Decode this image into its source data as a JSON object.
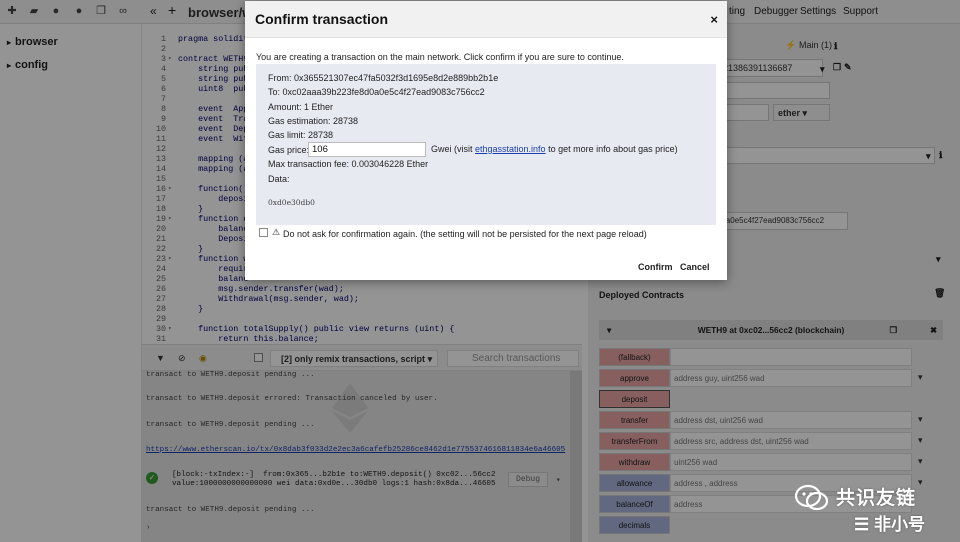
{
  "topbar": {
    "tab_name": "browser/we",
    "collapse_label": "«",
    "add_label": "+",
    "right_tabs": [
      "ting",
      "Debugger",
      "Settings",
      "Support"
    ]
  },
  "explorer": {
    "folders": [
      "browser",
      "config"
    ]
  },
  "editor": {
    "lines": [
      {
        "n": "1",
        "fold": "",
        "text": "pragma solidit"
      },
      {
        "n": "2",
        "fold": "",
        "text": ""
      },
      {
        "n": "3",
        "fold": "▾",
        "text": "contract WETH9"
      },
      {
        "n": "4",
        "fold": "",
        "text": "    string pub"
      },
      {
        "n": "5",
        "fold": "",
        "text": "    string pub"
      },
      {
        "n": "6",
        "fold": "",
        "text": "    uint8  pub"
      },
      {
        "n": "7",
        "fold": "",
        "text": ""
      },
      {
        "n": "8",
        "fold": "",
        "text": "    event  App"
      },
      {
        "n": "9",
        "fold": "",
        "text": "    event  Tra"
      },
      {
        "n": "10",
        "fold": "",
        "text": "    event  Dep"
      },
      {
        "n": "11",
        "fold": "",
        "text": "    event  Wit"
      },
      {
        "n": "12",
        "fold": "",
        "text": ""
      },
      {
        "n": "13",
        "fold": "",
        "text": "    mapping (a"
      },
      {
        "n": "14",
        "fold": "",
        "text": "    mapping (a"
      },
      {
        "n": "15",
        "fold": "",
        "text": ""
      },
      {
        "n": "16",
        "fold": "▾",
        "text": "    function()"
      },
      {
        "n": "17",
        "fold": "",
        "text": "        deposi"
      },
      {
        "n": "18",
        "fold": "",
        "text": "    }"
      },
      {
        "n": "19",
        "fold": "▾",
        "text": "    function d"
      },
      {
        "n": "20",
        "fold": "",
        "text": "        balanc"
      },
      {
        "n": "21",
        "fold": "",
        "text": "        Deposi"
      },
      {
        "n": "22",
        "fold": "",
        "text": "    }"
      },
      {
        "n": "23",
        "fold": "▾",
        "text": "    function w"
      },
      {
        "n": "24",
        "fold": "",
        "text": "        requir"
      },
      {
        "n": "25",
        "fold": "",
        "text": "        balanc"
      },
      {
        "n": "26",
        "fold": "",
        "text": "        msg.sender.transfer(wad);"
      },
      {
        "n": "27",
        "fold": "",
        "text": "        Withdrawal(msg.sender, wad);"
      },
      {
        "n": "28",
        "fold": "",
        "text": "    }"
      },
      {
        "n": "29",
        "fold": "",
        "text": ""
      },
      {
        "n": "30",
        "fold": "▾",
        "text": "    function totalSupply() public view returns (uint) {"
      },
      {
        "n": "31",
        "fold": "",
        "text": "        return this.balance;"
      },
      {
        "n": "32",
        "fold": "",
        "text": "    }"
      }
    ]
  },
  "terminal_toolbar": {
    "filter_label": "[2] only remix transactions, script",
    "search_placeholder": "Search transactions"
  },
  "terminal": {
    "line1": "transact to WETH9.deposit pending ...",
    "line2": "transact to WETH9.deposit errored: Transaction canceled by user.",
    "line3": "transact to WETH9.deposit pending ...",
    "line4": "https://www.etherscan.io/tx/0x8dab3f033d2e2ec3a6cafefb25286ce8462d1e7755374616811834e6a46605",
    "line5a": "[block:-txIndex:-]  from:0x365...b2b1e to:WETH9.deposit() 0xc02...56cc2",
    "line5b": "value:1000000000000000 wei data:0xd0e...30db0 logs:1 hash:0x8da...46605",
    "debug_label": "Debug",
    "line6": "transact to WETH9.deposit pending ..."
  },
  "runpanel": {
    "network": "Main (1)",
    "account": "51421386391136687",
    "value_unit": "ether",
    "address_display": "e8d0a0e5c4f27ead9083c756cc2",
    "deployed_title": "Deployed Contracts",
    "instance_title": "WETH9 at 0xc02...56cc2 (blockchain)",
    "functions": [
      {
        "label": "(fallback)",
        "kind": "tx",
        "input": "",
        "chev": false
      },
      {
        "label": "approve",
        "kind": "tx",
        "input": "address guy, uint256 wad",
        "chev": true
      },
      {
        "label": "deposit",
        "kind": "pay",
        "input": "",
        "chev": false
      },
      {
        "label": "transfer",
        "kind": "tx",
        "input": "address dst, uint256 wad",
        "chev": true
      },
      {
        "label": "transferFrom",
        "kind": "tx",
        "input": "address src, address dst, uint256 wad",
        "chev": true
      },
      {
        "label": "withdraw",
        "kind": "tx",
        "input": "uint256 wad",
        "chev": true
      },
      {
        "label": "allowance",
        "kind": "view",
        "input": "address , address",
        "chev": true
      },
      {
        "label": "balanceOf",
        "kind": "view",
        "input": "address",
        "chev": false
      },
      {
        "label": "decimals",
        "kind": "view",
        "input": "",
        "chev": false
      }
    ]
  },
  "modal": {
    "title": "Confirm transaction",
    "close": "×",
    "intro": "You are creating a transaction on the main network. Click confirm if you are sure to continue.",
    "from": "From: 0x365521307ec47fa5032f3d1695e8d2e889bb2b1e",
    "to": "To: 0xc02aaa39b223fe8d0a0e5c4f27ead9083c756cc2",
    "amount": "Amount: 1 Ether",
    "gas_estimation": "Gas estimation: 28738",
    "gas_limit": "Gas limit: 28738",
    "gas_price_label": "Gas price:",
    "gas_price_value": "106",
    "gas_unit_pre": "Gwei (visit ",
    "gas_link": "ethgasstation.info",
    "gas_unit_post": " to get more info about gas price)",
    "max_fee": "Max transaction fee: 0.003046228 Ether",
    "data_label": "Data:",
    "data_value": "0xd0e30db0",
    "noask_label": "Do not ask for confirmation again. (the setting will not be persisted for the next page reload)",
    "confirm": "Confirm",
    "cancel": "Cancel"
  },
  "watermark": {
    "line1": "共识友链",
    "line2": "非小号"
  },
  "colors": {
    "tx_button": "#e9a4a4",
    "view_button": "#a7b3dd",
    "link": "#1a3fb0",
    "info_bg": "#e8eaf2"
  }
}
